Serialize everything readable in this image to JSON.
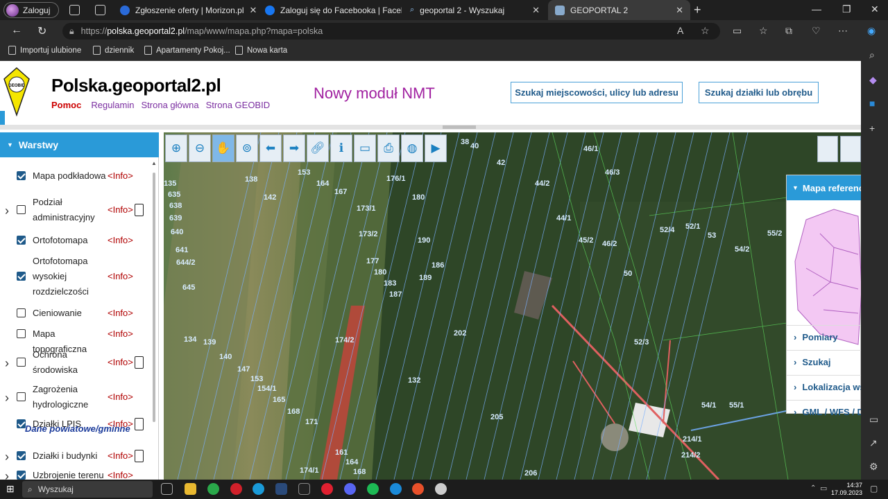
{
  "browser": {
    "profile_label": "Zaloguj",
    "tabs": [
      {
        "title": "Zgłoszenie oferty | Morizon.pl",
        "active": false
      },
      {
        "title": "Zaloguj się do Facebooka | Faceb",
        "active": false
      },
      {
        "title": "geoportal 2 - Wyszukaj",
        "active": false
      },
      {
        "title": "GEOPORTAL 2",
        "active": true
      }
    ],
    "url_scheme": "https://",
    "url_host": "polska.geoportal2.pl",
    "url_path": "/map/www/mapa.php?mapa=polska",
    "favorites": [
      "Importuj ulubione",
      "dziennik",
      "Apartamenty Pokoj...",
      "Nowa karta"
    ]
  },
  "header": {
    "logo_text": "GEOBID",
    "site_title": "Polska.geoportal2.pl",
    "links": [
      "Pomoc",
      "Regulamin",
      "Strona główna",
      "Strona GEOBID"
    ],
    "nmt_label": "Nowy moduł NMT",
    "search_address_button": "Szukaj miejscowości, ulicy lub adresu",
    "search_parcel_button": "Szukaj działki lub obrębu"
  },
  "layers_panel": {
    "title": "Warstwy",
    "info_label": "<Info>",
    "section_label": "Dane powiatowe/gminne",
    "items": [
      {
        "name": "Mapa podkładowa",
        "checked": true,
        "expandable": false,
        "doc": false
      },
      {
        "name": "Podział administracyjny",
        "checked": false,
        "expandable": true,
        "doc": true
      },
      {
        "name": "Ortofotomapa",
        "checked": true,
        "expandable": false,
        "doc": false
      },
      {
        "name": "Ortofotomapa wysokiej rozdzielczości",
        "checked": true,
        "expandable": false,
        "doc": false
      },
      {
        "name": "Cieniowanie",
        "checked": false,
        "expandable": false,
        "doc": false
      },
      {
        "name": "Mapa topograficzna",
        "checked": false,
        "expandable": false,
        "doc": false
      },
      {
        "name": "Ochrona środowiska",
        "checked": false,
        "expandable": true,
        "doc": true
      },
      {
        "name": "Zagrożenia hydrologiczne",
        "checked": false,
        "expandable": true,
        "doc": false
      },
      {
        "name": "Działki LPIS",
        "checked": true,
        "expandable": false,
        "doc": true
      },
      {
        "name": "Działki i budynki",
        "checked": true,
        "expandable": true,
        "doc": true
      },
      {
        "name": "Uzbrojenie terenu",
        "checked": true,
        "expandable": true,
        "doc": false
      }
    ]
  },
  "map": {
    "toolbar": [
      "zoom-in-icon",
      "zoom-out-icon",
      "pan-hand-icon",
      "zoom-extent-icon",
      "back-arrow-icon",
      "forward-arrow-icon",
      "link-icon",
      "info-icon",
      "measure-icon",
      "print-icon",
      "globe-icon",
      "video-icon"
    ],
    "parcel_labels": [
      "38",
      "40",
      "42",
      "44/2",
      "46/1",
      "46/3",
      "44/1",
      "45/2",
      "46/2",
      "50",
      "52/4",
      "52/1",
      "53",
      "54/2",
      "55/2",
      "153",
      "164",
      "167",
      "176/1",
      "180",
      "173/1",
      "173/2",
      "190",
      "177",
      "180",
      "183",
      "187",
      "186",
      "189",
      "202",
      "174/2",
      "52/3",
      "54/1",
      "55/1",
      "132",
      "205",
      "214/1",
      "214/2",
      "171",
      "161",
      "164",
      "168",
      "174/1",
      "206",
      "135",
      "138",
      "142",
      "635",
      "638",
      "639",
      "640",
      "641",
      "644/2",
      "645",
      "134",
      "139",
      "140",
      "147",
      "153",
      "154/1",
      "165",
      "168"
    ],
    "reference_panel": {
      "title": "Mapa referencyjna",
      "items": [
        "Pomiary",
        "Szukaj",
        "Lokalizacja wsp",
        "GML / WFS / DXF"
      ]
    }
  },
  "taskbar": {
    "search_placeholder": "Wyszukaj",
    "time": "14:37",
    "date": "17.09.2023"
  }
}
